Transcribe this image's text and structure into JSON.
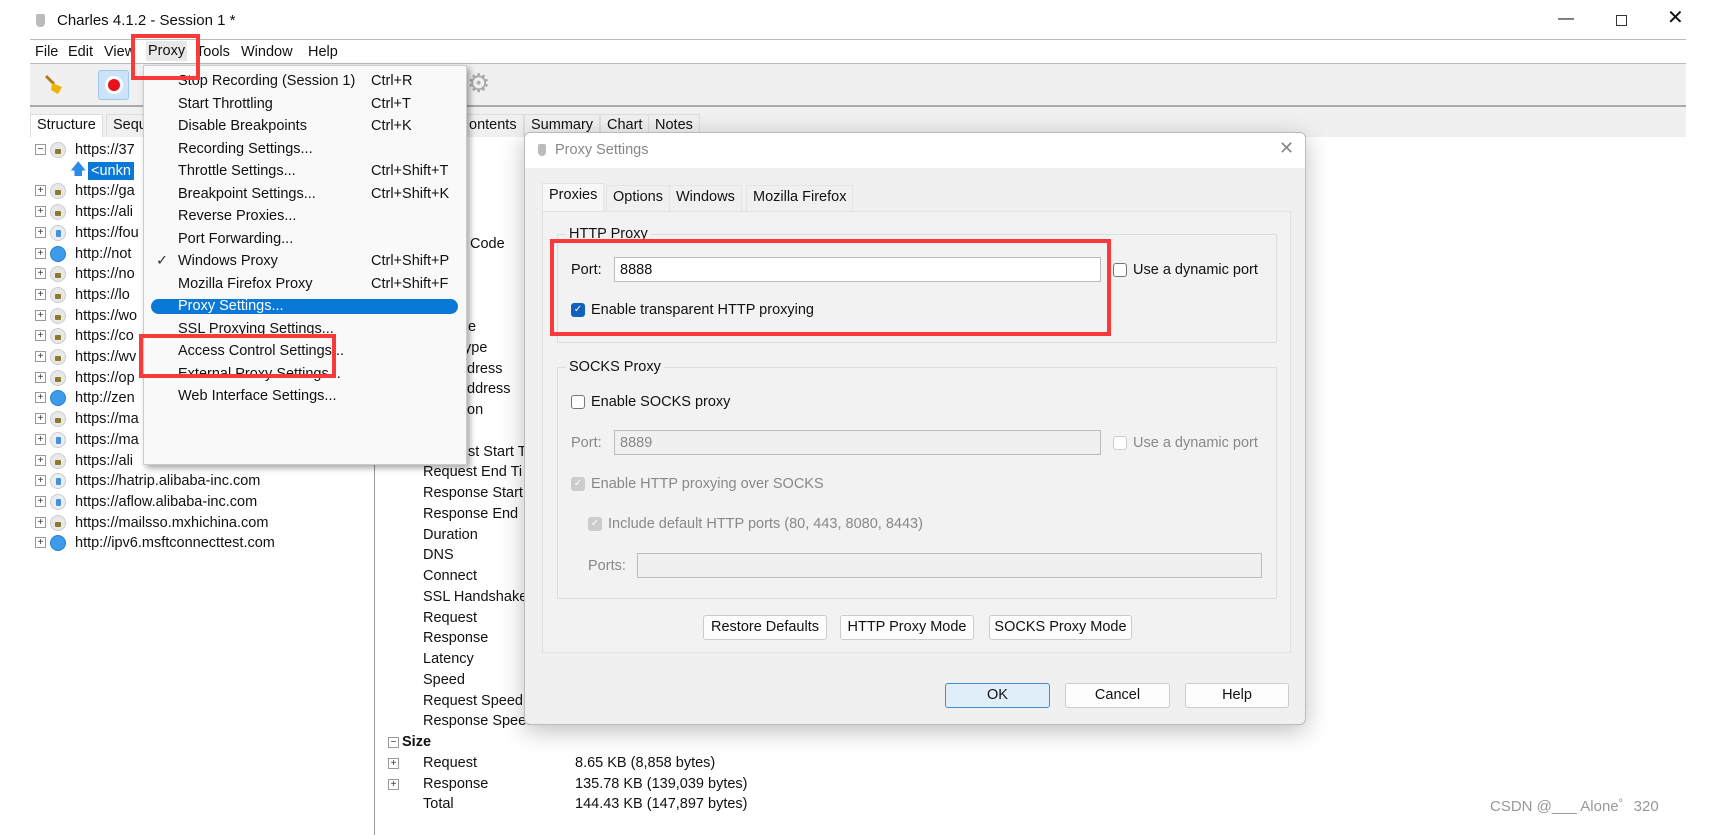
{
  "window": {
    "title": "Charles 4.1.2 - Session 1 *",
    "controls": [
      "minimize",
      "maximize",
      "close"
    ]
  },
  "menubar": {
    "items": [
      "File",
      "Edit",
      "View",
      "Proxy",
      "Tools",
      "Window",
      "Help"
    ],
    "active": "Proxy"
  },
  "toolbar": {
    "icons": [
      "broom-icon",
      "record-icon",
      "gear-icon"
    ]
  },
  "left_tabs": [
    "Structure",
    "Sequ"
  ],
  "tree": [
    {
      "label": "https://37",
      "icon": "lock",
      "expanded": true,
      "level": 0
    },
    {
      "label": "<unkn",
      "icon": "arrow",
      "level": 1,
      "selected": true
    },
    {
      "label": "https://ga",
      "icon": "lock",
      "level": 0
    },
    {
      "label": "https://ali",
      "icon": "lock",
      "level": 0
    },
    {
      "label": "https://fou",
      "icon": "lockb",
      "level": 0
    },
    {
      "label": "http://not",
      "icon": "globe",
      "level": 0
    },
    {
      "label": "https://no",
      "icon": "lock",
      "level": 0
    },
    {
      "label": "https://lo",
      "icon": "lock",
      "level": 0
    },
    {
      "label": "https://wo",
      "icon": "lock",
      "level": 0
    },
    {
      "label": "https://co",
      "icon": "lock",
      "level": 0
    },
    {
      "label": "https://wv",
      "icon": "lock",
      "level": 0
    },
    {
      "label": "https://op",
      "icon": "lock",
      "level": 0
    },
    {
      "label": "http://zen",
      "icon": "globe",
      "level": 0
    },
    {
      "label": "https://ma",
      "icon": "lock",
      "level": 0
    },
    {
      "label": "https://ma",
      "icon": "lockb",
      "level": 0
    },
    {
      "label": "https://ali",
      "icon": "lock",
      "level": 0
    },
    {
      "label": "https://hatrip.alibaba-inc.com",
      "icon": "lockb",
      "level": 0
    },
    {
      "label": "https://aflow.alibaba-inc.com",
      "icon": "lockb",
      "level": 0
    },
    {
      "label": "https://mailsso.mxhichina.com",
      "icon": "lock",
      "level": 0
    },
    {
      "label": "http://ipv6.msftconnecttest.com",
      "icon": "globe",
      "level": 0
    }
  ],
  "main_tabs": [
    "ontents",
    "Summary",
    "Chart",
    "Notes"
  ],
  "details": [
    {
      "label": "Code"
    },
    {
      "label": "e"
    },
    {
      "label": "ype"
    },
    {
      "label": "dress"
    },
    {
      "label": "ddress"
    },
    {
      "label": "on"
    },
    {
      "label": "st Start T"
    },
    {
      "label": "Request End Ti"
    },
    {
      "label": "Response Start"
    },
    {
      "label": "Response End"
    },
    {
      "label": "Duration"
    },
    {
      "label": "DNS"
    },
    {
      "label": "Connect"
    },
    {
      "label": "SSL Handshake"
    },
    {
      "label": "Request"
    },
    {
      "label": "Response"
    },
    {
      "label": "Latency"
    },
    {
      "label": "Speed"
    },
    {
      "label": "Request Speed"
    },
    {
      "label": "Response Speed"
    },
    {
      "label": "Size",
      "bold": true,
      "expander": "minus"
    },
    {
      "label": "Request",
      "value": "8.65 KB (8,858 bytes)",
      "expander": "plus"
    },
    {
      "label": "Response",
      "value": "135.78 KB (139,039 bytes)",
      "expander": "plus"
    },
    {
      "label": "Total",
      "value": "144.43 KB (147,897 bytes)"
    }
  ],
  "proxy_menu": [
    {
      "label": "Stop Recording (Session 1)",
      "shortcut": "Ctrl+R"
    },
    {
      "label": "Start Throttling",
      "shortcut": "Ctrl+T"
    },
    {
      "label": "Disable Breakpoints",
      "shortcut": "Ctrl+K"
    },
    {
      "sep": true
    },
    {
      "label": "Recording Settings..."
    },
    {
      "label": "Throttle Settings...",
      "shortcut": "Ctrl+Shift+T"
    },
    {
      "label": "Breakpoint Settings...",
      "shortcut": "Ctrl+Shift+K"
    },
    {
      "sep": true
    },
    {
      "label": "Reverse Proxies..."
    },
    {
      "label": "Port Forwarding..."
    },
    {
      "sep": true
    },
    {
      "label": "Windows Proxy",
      "shortcut": "Ctrl+Shift+P",
      "checked": true
    },
    {
      "label": "Mozilla Firefox Proxy",
      "shortcut": "Ctrl+Shift+F"
    },
    {
      "sep": true
    },
    {
      "label": "Proxy Settings...",
      "highlighted": true
    },
    {
      "label": "SSL Proxying Settings..."
    },
    {
      "label": "Access Control Settings..."
    },
    {
      "label": "External Proxy Settings..."
    },
    {
      "label": "Web Interface Settings..."
    }
  ],
  "dialog": {
    "title": "Proxy Settings",
    "tabs": [
      "Proxies",
      "Options",
      "Windows",
      "Mozilla Firefox"
    ],
    "active_tab": "Proxies",
    "http": {
      "group": "HTTP Proxy",
      "port_label": "Port:",
      "port": "8888",
      "dynamic_label": "Use a dynamic port",
      "dynamic": false,
      "transparent_label": "Enable transparent HTTP proxying",
      "transparent": true
    },
    "socks": {
      "group": "SOCKS Proxy",
      "enable_label": "Enable SOCKS proxy",
      "enable": false,
      "port_label": "Port:",
      "port": "8889",
      "dynamic_label": "Use a dynamic port",
      "over_socks_label": "Enable HTTP proxying over SOCKS",
      "over_socks": true,
      "include_label": "Include default HTTP ports (80, 443, 8080, 8443)",
      "include": true,
      "ports_label": "Ports:",
      "ports": ""
    },
    "buttons": {
      "restore": "Restore Defaults",
      "http_mode": "HTTP Proxy Mode",
      "socks_mode": "SOCKS Proxy Mode",
      "ok": "OK",
      "cancel": "Cancel",
      "help": "Help"
    }
  },
  "watermark": "CSDN @___ Alone゜320",
  "colors": {
    "highlight": "#0a78d7",
    "annotation_red": "#fa3a3a",
    "selection": "#0a78d7"
  }
}
